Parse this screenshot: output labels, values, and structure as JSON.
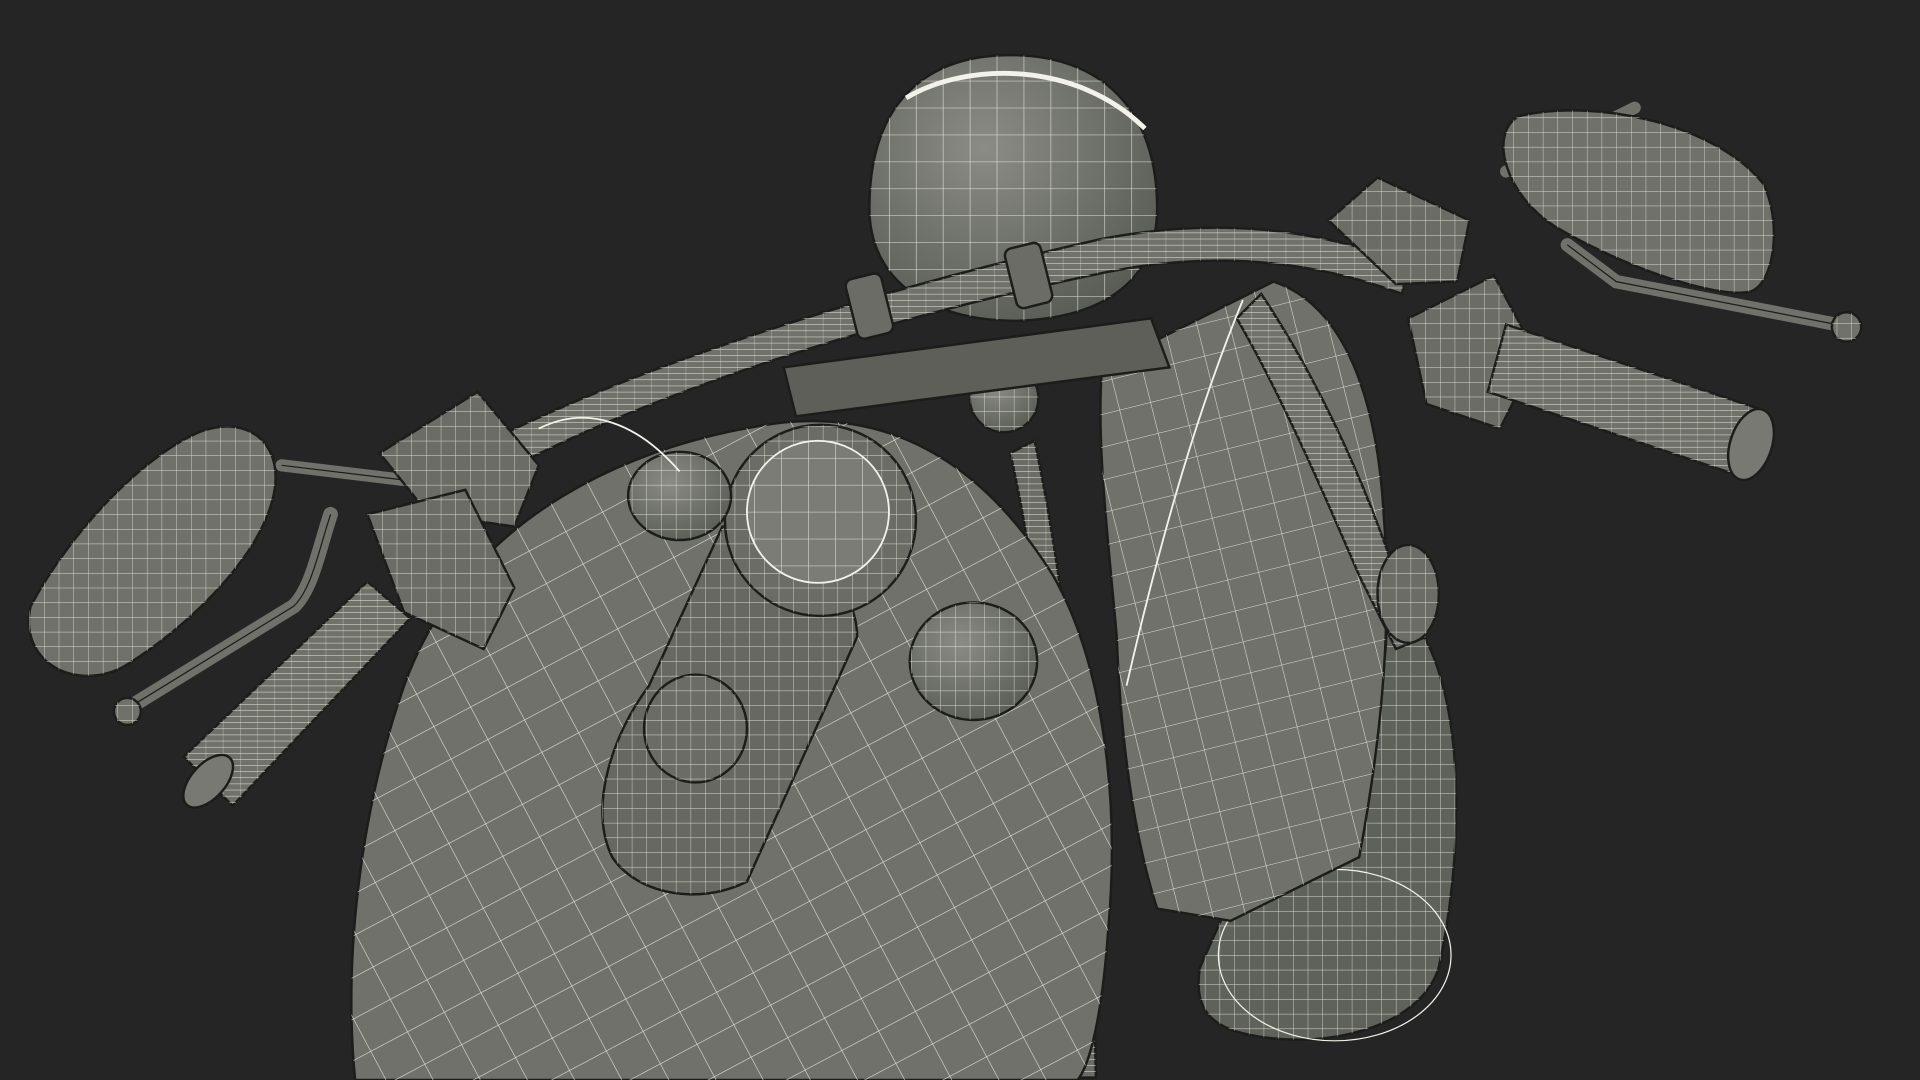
{
  "scene": {
    "subject": "motorcycle-wireframe-render",
    "colors": {
      "background": "#252525",
      "surface": "#6f716a",
      "surface_dark": "#5d5f58",
      "surface_light": "#858780",
      "wire": "#f2f2ea",
      "outline": "#1c1c1a"
    }
  }
}
